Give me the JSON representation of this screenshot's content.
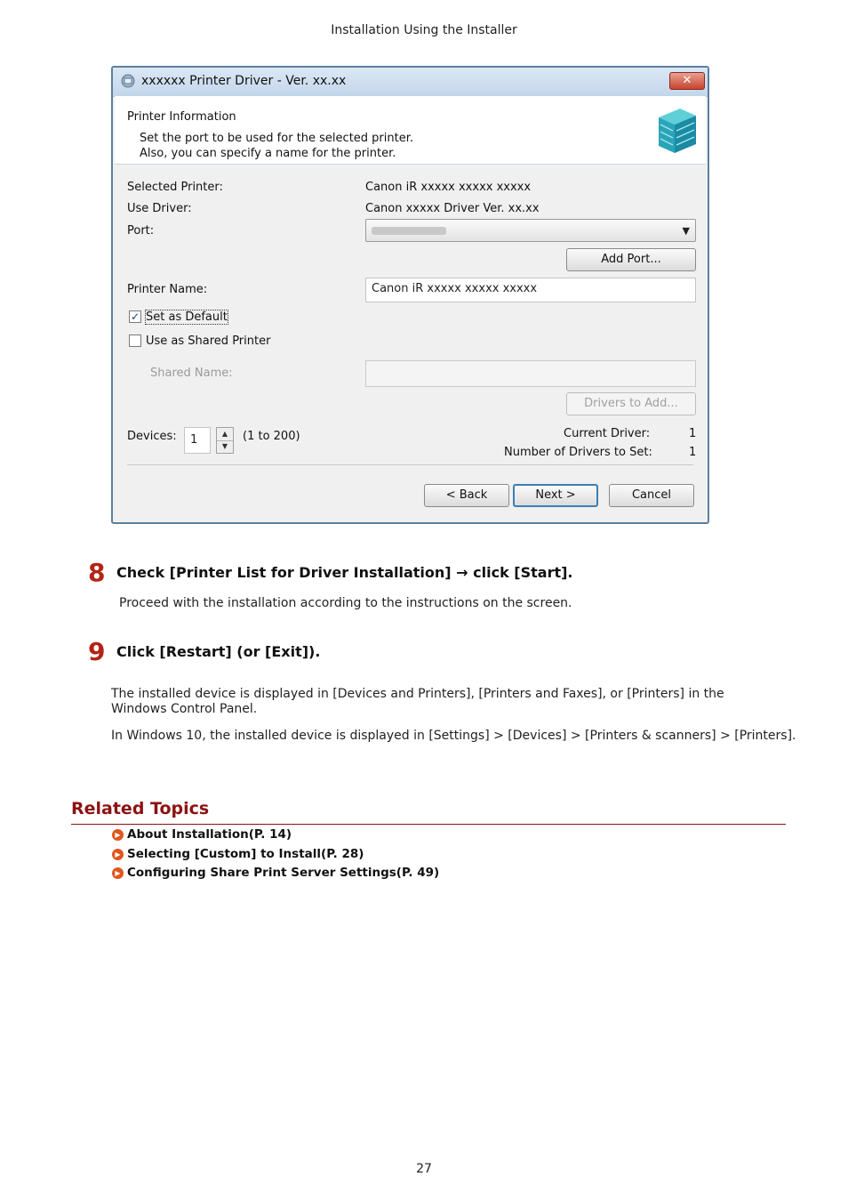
{
  "page": {
    "header": "Installation Using the Installer",
    "page_number": "27"
  },
  "dialog": {
    "title": "xxxxxx Printer Driver - Ver. xx.xx",
    "close_label": "✕",
    "info_title": "Printer Information",
    "info_line1": "Set the port to be used for the selected printer.",
    "info_line2": "Also, you can specify a name for the printer.",
    "selected_printer_label": "Selected Printer:",
    "selected_printer_value": "Canon iR xxxxx xxxxx xxxxx",
    "use_driver_label": "Use Driver:",
    "use_driver_value": "Canon xxxxx Driver Ver. xx.xx",
    "port_label": "Port:",
    "add_port_button": "Add Port...",
    "printer_name_label": "Printer Name:",
    "printer_name_value": "Canon iR xxxxx xxxxx xxxxx",
    "set_default_label": "Set as Default",
    "set_default_checked": true,
    "shared_printer_label": "Use as Shared Printer",
    "shared_printer_checked": false,
    "shared_name_label": "Shared Name:",
    "drivers_to_add_button": "Drivers to Add...",
    "devices_label": "Devices:",
    "devices_value": "1",
    "devices_range": "(1 to 200)",
    "current_driver_label": "Current Driver:",
    "current_driver_value": "1",
    "drivers_to_set_label": "Number of Drivers to Set:",
    "drivers_to_set_value": "1",
    "back_button": "< Back",
    "next_button": "Next >",
    "cancel_button": "Cancel"
  },
  "steps": [
    {
      "number": "8",
      "text": "Check [Printer List for Driver Installation] → click [Start].",
      "detail": "Proceed with the installation according to the instructions on the screen."
    },
    {
      "number": "9",
      "text": "Click [Restart] (or [Exit]).",
      "detail1": "The installed device is displayed in [Devices and Printers], [Printers and Faxes], or [Printers] in the Windows Control Panel.",
      "detail2": "In Windows 10, the installed device is displayed in [Settings] > [Devices] > [Printers & scanners] > [Printers]."
    }
  ],
  "related": {
    "title": "Related Topics",
    "links": [
      "About Installation(P. 14)",
      "Selecting [Custom] to Install(P. 28)",
      "Configuring Share Print Server Settings(P. 49)"
    ]
  },
  "colors": {
    "accent_red": "#b32416",
    "related_title": "#8d1212",
    "link_icon": "#e0561d"
  }
}
